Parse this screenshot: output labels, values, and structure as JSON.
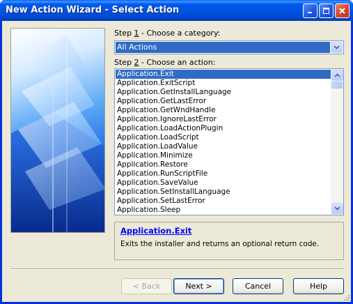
{
  "window": {
    "title": "New Action Wizard - Select Action",
    "controls": [
      "minimize-icon",
      "maximize-icon",
      "close-icon"
    ]
  },
  "step1": {
    "label_pre": "Step ",
    "label_key": "1",
    "label_post": " - Choose a category:",
    "selected_category": "All Actions"
  },
  "step2": {
    "label_pre": "Step ",
    "label_key": "2",
    "label_post": " - Choose an action:",
    "actions": [
      {
        "label": "Application.Exit",
        "selected": true
      },
      {
        "label": "Application.ExitScript"
      },
      {
        "label": "Application.GetInstallLanguage"
      },
      {
        "label": "Application.GetLastError"
      },
      {
        "label": "Application.GetWndHandle"
      },
      {
        "label": "Application.IgnoreLastError"
      },
      {
        "label": "Application.LoadActionPlugin"
      },
      {
        "label": "Application.LoadScript"
      },
      {
        "label": "Application.LoadValue"
      },
      {
        "label": "Application.Minimize"
      },
      {
        "label": "Application.Restore"
      },
      {
        "label": "Application.RunScriptFile"
      },
      {
        "label": "Application.SaveValue"
      },
      {
        "label": "Application.SetInstallLanguage"
      },
      {
        "label": "Application.SetLastError"
      },
      {
        "label": "Application.Sleep"
      }
    ]
  },
  "description": {
    "title": "Application.Exit",
    "text": "Exits the installer and returns an optional return code."
  },
  "buttons": {
    "back": "< Back",
    "next": "Next >",
    "cancel": "Cancel",
    "help": "Help"
  },
  "colors": {
    "titlebar": "#0054e3",
    "selection": "#316ac5",
    "dialog_bg": "#ece9d8",
    "link": "#0000ff"
  }
}
